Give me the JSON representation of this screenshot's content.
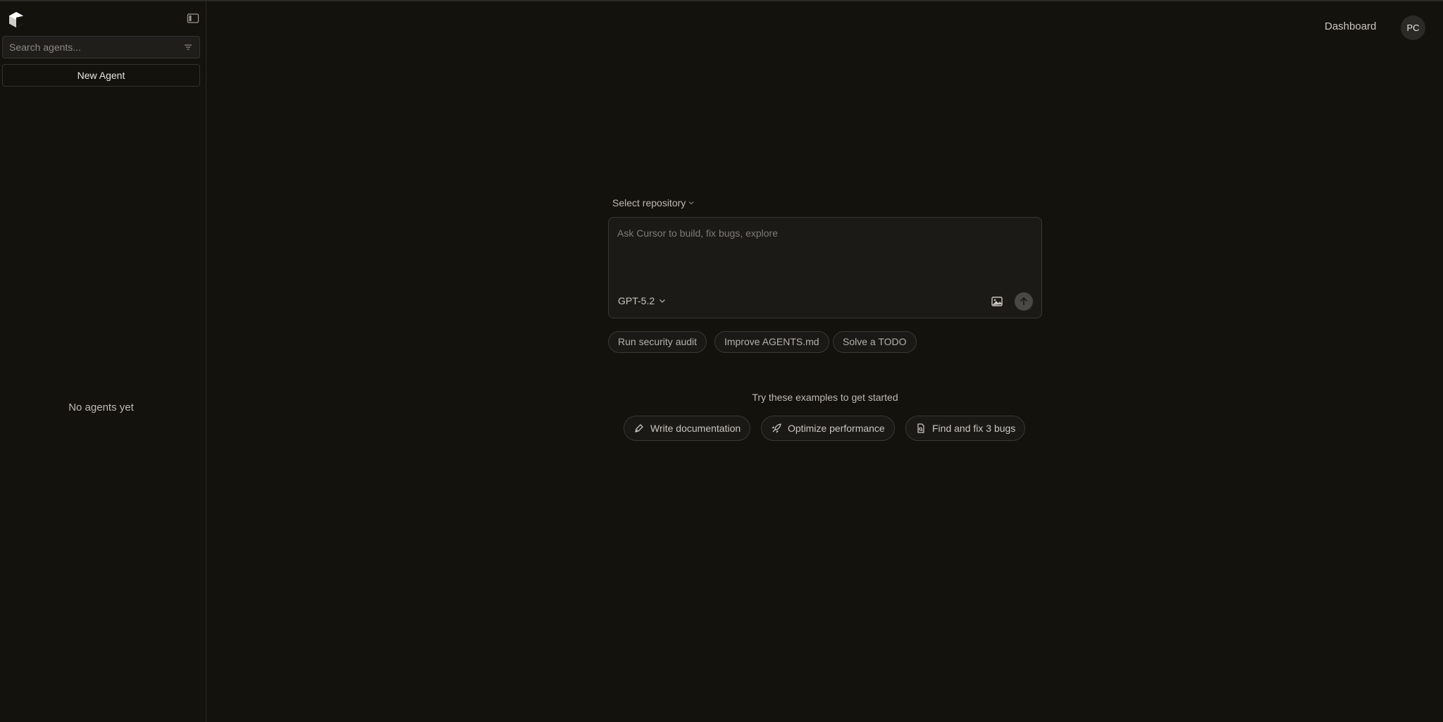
{
  "sidebar": {
    "search_placeholder": "Search agents...",
    "new_agent_label": "New Agent",
    "empty_state": "No agents yet"
  },
  "topbar": {
    "dashboard_label": "Dashboard",
    "avatar_initials": "PC"
  },
  "composer": {
    "repo_select_label": "Select repository",
    "input_placeholder": "Ask Cursor to build, fix bugs, explore",
    "model_label": "GPT-5.2"
  },
  "suggestions": [
    {
      "label": "Run security audit"
    },
    {
      "label": "Improve AGENTS.md"
    },
    {
      "label": "Solve a TODO"
    }
  ],
  "examples": {
    "title": "Try these examples to get started",
    "items": [
      {
        "label": "Write documentation",
        "icon": "pen-icon"
      },
      {
        "label": "Optimize performance",
        "icon": "rocket-icon"
      },
      {
        "label": "Find and fix 3 bugs",
        "icon": "file-search-icon"
      }
    ]
  },
  "colors": {
    "background": "#14120d",
    "panel": "#1b1a16",
    "border": "#3a3833",
    "text": "#e8e6e1"
  }
}
